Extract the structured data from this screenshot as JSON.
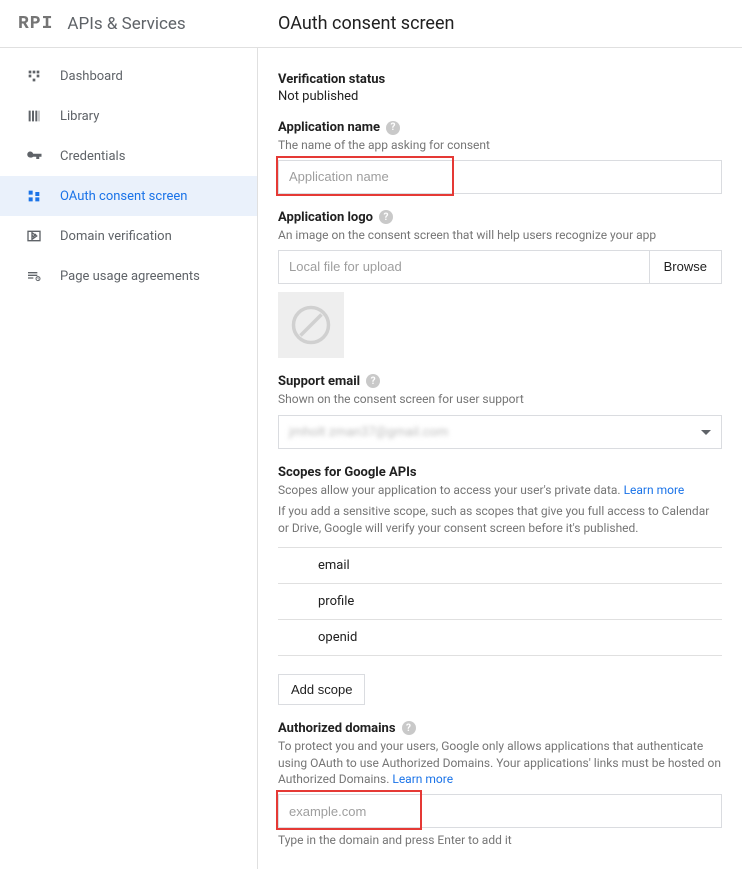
{
  "header": {
    "logo_text": "RPI",
    "product_title": "APIs & Services",
    "page_title": "OAuth consent screen"
  },
  "sidebar": {
    "items": [
      {
        "label": "Dashboard",
        "icon": "dashboard-icon"
      },
      {
        "label": "Library",
        "icon": "library-icon"
      },
      {
        "label": "Credentials",
        "icon": "credentials-icon"
      },
      {
        "label": "OAuth consent screen",
        "icon": "consent-icon"
      },
      {
        "label": "Domain verification",
        "icon": "domain-icon"
      },
      {
        "label": "Page usage agreements",
        "icon": "agreements-icon"
      }
    ],
    "active_index": 3
  },
  "verification": {
    "label": "Verification status",
    "value": "Not published"
  },
  "app_name": {
    "label": "Application name",
    "hint": "The name of the app asking for consent",
    "placeholder": "Application name"
  },
  "app_logo": {
    "label": "Application logo",
    "hint": "An image on the consent screen that will help users recognize your app",
    "placeholder": "Local file for upload",
    "browse_label": "Browse"
  },
  "support_email": {
    "label": "Support email",
    "hint": "Shown on the consent screen for user support",
    "value_blurred": "jmholt zman37@gmail.com"
  },
  "scopes": {
    "label": "Scopes for Google APIs",
    "hint_prefix": "Scopes allow your application to access your user's private data. ",
    "learn_more": "Learn more",
    "sensitive_hint": "If you add a sensitive scope, such as scopes that give you full access to Calendar or Drive, Google will verify your consent screen before it's published.",
    "items": [
      "email",
      "profile",
      "openid"
    ],
    "add_label": "Add scope"
  },
  "auth_domains": {
    "label": "Authorized domains",
    "hint_prefix": "To protect you and your users, Google only allows applications that authenticate using OAuth to use Authorized Domains. Your applications' links must be hosted on Authorized Domains. ",
    "learn_more": "Learn more",
    "placeholder": "example.com",
    "enter_hint": "Type in the domain and press Enter to add it"
  }
}
